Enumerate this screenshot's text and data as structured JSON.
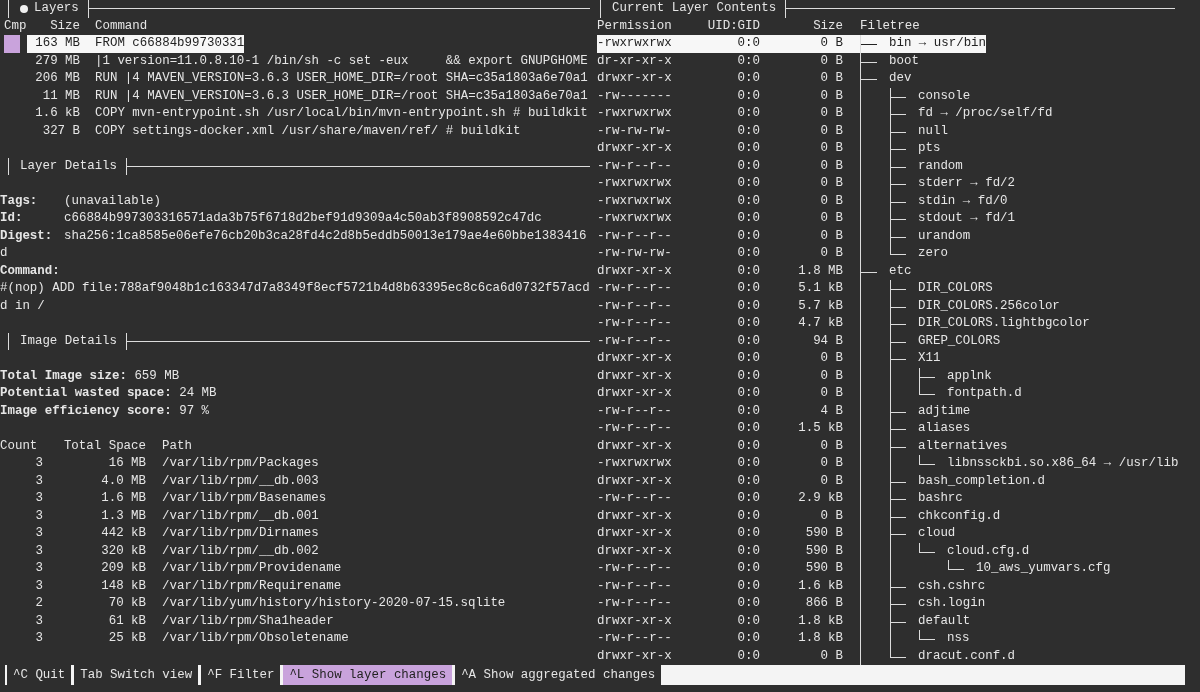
{
  "layers_pane": {
    "title": "Layers",
    "focused": true,
    "columns": [
      "Cmp",
      "Size",
      "Command"
    ],
    "rows": [
      {
        "compared": true,
        "size": "163 MB",
        "command": "FROM c66884b99730331",
        "selected": true
      },
      {
        "compared": false,
        "size": "279 MB",
        "command": "|1 version=11.0.8.10-1 /bin/sh -c set -eux     && export GNUPGHOME",
        "selected": false
      },
      {
        "compared": false,
        "size": "206 MB",
        "command": "RUN |4 MAVEN_VERSION=3.6.3 USER_HOME_DIR=/root SHA=c35a1803a6e70a1",
        "selected": false
      },
      {
        "compared": false,
        "size": "11 MB",
        "command": "RUN |4 MAVEN_VERSION=3.6.3 USER_HOME_DIR=/root SHA=c35a1803a6e70a1",
        "selected": false
      },
      {
        "compared": false,
        "size": "1.6 kB",
        "command": "COPY mvn-entrypoint.sh /usr/local/bin/mvn-entrypoint.sh # buildkit",
        "selected": false
      },
      {
        "compared": false,
        "size": "327 B",
        "command": "COPY settings-docker.xml /usr/share/maven/ref/ # buildkit",
        "selected": false
      }
    ]
  },
  "layer_details": {
    "title": "Layer Details",
    "focused": false,
    "fields": [
      {
        "label": "Tags:",
        "value": "(unavailable)"
      },
      {
        "label": "Id:",
        "value": "c66884b997303316571ada3b75f6718d2bef91d9309a4c50ab3f8908592c47dc"
      },
      {
        "label": "Digest:",
        "value": "sha256:1ca8585e06efe76cb20b3ca28fd4c2d8b5eddb50013e179ae4e60bbe1383416d"
      }
    ],
    "command_label": "Command:",
    "command": "#(nop) ADD file:788af9048b1c163347d7a8349f8ecf5721b4d8b63395ec8c6ca6d0732f57acdd in /"
  },
  "image_details": {
    "title": "Image Details",
    "focused": false,
    "stats": [
      {
        "label": "Total Image size:",
        "value": "659 MB"
      },
      {
        "label": "Potential wasted space:",
        "value": "24 MB"
      },
      {
        "label": "Image efficiency score:",
        "value": "97 %"
      }
    ],
    "columns": [
      "Count",
      "Total Space",
      "Path"
    ],
    "rows": [
      {
        "count": "3",
        "space": "16 MB",
        "path": "/var/lib/rpm/Packages"
      },
      {
        "count": "3",
        "space": "4.0 MB",
        "path": "/var/lib/rpm/__db.003"
      },
      {
        "count": "3",
        "space": "1.6 MB",
        "path": "/var/lib/rpm/Basenames"
      },
      {
        "count": "3",
        "space": "1.3 MB",
        "path": "/var/lib/rpm/__db.001"
      },
      {
        "count": "3",
        "space": "442 kB",
        "path": "/var/lib/rpm/Dirnames"
      },
      {
        "count": "3",
        "space": "320 kB",
        "path": "/var/lib/rpm/__db.002"
      },
      {
        "count": "3",
        "space": "209 kB",
        "path": "/var/lib/rpm/Providename"
      },
      {
        "count": "3",
        "space": "148 kB",
        "path": "/var/lib/rpm/Requirename"
      },
      {
        "count": "2",
        "space": "70 kB",
        "path": "/var/lib/yum/history/history-2020-07-15.sqlite"
      },
      {
        "count": "3",
        "space": "61 kB",
        "path": "/var/lib/rpm/Sha1header"
      },
      {
        "count": "3",
        "space": "25 kB",
        "path": "/var/lib/rpm/Obsoletename"
      }
    ]
  },
  "contents_pane": {
    "title": "Current Layer Contents",
    "focused": false,
    "columns": [
      "Permission",
      "UID:GID",
      "Size",
      "Filetree"
    ],
    "tree": [
      {
        "permission": "-rwxrwxrwx",
        "uid_gid": "0:0",
        "size": "0 B",
        "name": "bin → usr/bin",
        "selected": true
      },
      {
        "permission": "dr-xr-xr-x",
        "uid_gid": "0:0",
        "size": "0 B",
        "name": "boot",
        "selected": false
      },
      {
        "permission": "drwxr-xr-x",
        "uid_gid": "0:0",
        "size": "0 B",
        "name": "dev",
        "selected": false,
        "children": [
          {
            "permission": "-rw-------",
            "uid_gid": "0:0",
            "size": "0 B",
            "name": "console",
            "selected": false
          },
          {
            "permission": "-rwxrwxrwx",
            "uid_gid": "0:0",
            "size": "0 B",
            "name": "fd → /proc/self/fd",
            "selected": false
          },
          {
            "permission": "-rw-rw-rw-",
            "uid_gid": "0:0",
            "size": "0 B",
            "name": "null",
            "selected": false
          },
          {
            "permission": "drwxr-xr-x",
            "uid_gid": "0:0",
            "size": "0 B",
            "name": "pts",
            "selected": false
          },
          {
            "permission": "-rw-r--r--",
            "uid_gid": "0:0",
            "size": "0 B",
            "name": "random",
            "selected": false
          },
          {
            "permission": "-rwxrwxrwx",
            "uid_gid": "0:0",
            "size": "0 B",
            "name": "stderr → fd/2",
            "selected": false
          },
          {
            "permission": "-rwxrwxrwx",
            "uid_gid": "0:0",
            "size": "0 B",
            "name": "stdin → fd/0",
            "selected": false
          },
          {
            "permission": "-rwxrwxrwx",
            "uid_gid": "0:0",
            "size": "0 B",
            "name": "stdout → fd/1",
            "selected": false
          },
          {
            "permission": "-rw-r--r--",
            "uid_gid": "0:0",
            "size": "0 B",
            "name": "urandom",
            "selected": false
          },
          {
            "permission": "-rw-rw-rw-",
            "uid_gid": "0:0",
            "size": "0 B",
            "name": "zero",
            "selected": false
          }
        ]
      },
      {
        "permission": "drwxr-xr-x",
        "uid_gid": "0:0",
        "size": "1.8 MB",
        "name": "etc",
        "selected": false,
        "children": [
          {
            "permission": "-rw-r--r--",
            "uid_gid": "0:0",
            "size": "5.1 kB",
            "name": "DIR_COLORS",
            "selected": false
          },
          {
            "permission": "-rw-r--r--",
            "uid_gid": "0:0",
            "size": "5.7 kB",
            "name": "DIR_COLORS.256color",
            "selected": false
          },
          {
            "permission": "-rw-r--r--",
            "uid_gid": "0:0",
            "size": "4.7 kB",
            "name": "DIR_COLORS.lightbgcolor",
            "selected": false
          },
          {
            "permission": "-rw-r--r--",
            "uid_gid": "0:0",
            "size": "94 B",
            "name": "GREP_COLORS",
            "selected": false
          },
          {
            "permission": "drwxr-xr-x",
            "uid_gid": "0:0",
            "size": "0 B",
            "name": "X11",
            "selected": false,
            "children": [
              {
                "permission": "drwxr-xr-x",
                "uid_gid": "0:0",
                "size": "0 B",
                "name": "applnk",
                "selected": false
              },
              {
                "permission": "drwxr-xr-x",
                "uid_gid": "0:0",
                "size": "0 B",
                "name": "fontpath.d",
                "selected": false
              }
            ]
          },
          {
            "permission": "-rw-r--r--",
            "uid_gid": "0:0",
            "size": "4 B",
            "name": "adjtime",
            "selected": false
          },
          {
            "permission": "-rw-r--r--",
            "uid_gid": "0:0",
            "size": "1.5 kB",
            "name": "aliases",
            "selected": false
          },
          {
            "permission": "drwxr-xr-x",
            "uid_gid": "0:0",
            "size": "0 B",
            "name": "alternatives",
            "selected": false,
            "children": [
              {
                "permission": "-rwxrwxrwx",
                "uid_gid": "0:0",
                "size": "0 B",
                "name": "libnssckbi.so.x86_64 → /usr/lib",
                "selected": false
              }
            ]
          },
          {
            "permission": "drwxr-xr-x",
            "uid_gid": "0:0",
            "size": "0 B",
            "name": "bash_completion.d",
            "selected": false
          },
          {
            "permission": "-rw-r--r--",
            "uid_gid": "0:0",
            "size": "2.9 kB",
            "name": "bashrc",
            "selected": false
          },
          {
            "permission": "drwxr-xr-x",
            "uid_gid": "0:0",
            "size": "0 B",
            "name": "chkconfig.d",
            "selected": false
          },
          {
            "permission": "drwxr-xr-x",
            "uid_gid": "0:0",
            "size": "590 B",
            "name": "cloud",
            "selected": false,
            "children": [
              {
                "permission": "drwxr-xr-x",
                "uid_gid": "0:0",
                "size": "590 B",
                "name": "cloud.cfg.d",
                "selected": false,
                "children": [
                  {
                    "permission": "-rw-r--r--",
                    "uid_gid": "0:0",
                    "size": "590 B",
                    "name": "10_aws_yumvars.cfg",
                    "selected": false
                  }
                ]
              }
            ]
          },
          {
            "permission": "-rw-r--r--",
            "uid_gid": "0:0",
            "size": "1.6 kB",
            "name": "csh.cshrc",
            "selected": false
          },
          {
            "permission": "-rw-r--r--",
            "uid_gid": "0:0",
            "size": "866 B",
            "name": "csh.login",
            "selected": false
          },
          {
            "permission": "drwxr-xr-x",
            "uid_gid": "0:0",
            "size": "1.8 kB",
            "name": "default",
            "selected": false,
            "children": [
              {
                "permission": "-rw-r--r--",
                "uid_gid": "0:0",
                "size": "1.8 kB",
                "name": "nss",
                "selected": false
              }
            ]
          },
          {
            "permission": "drwxr-xr-x",
            "uid_gid": "0:0",
            "size": "0 B",
            "name": "dracut.conf.d",
            "selected": false
          }
        ]
      }
    ]
  },
  "key_bar": [
    {
      "label": "^C Quit",
      "active": false
    },
    {
      "label": "Tab Switch view",
      "active": false
    },
    {
      "label": "^F Filter",
      "active": false
    },
    {
      "label": "^L Show layer changes",
      "active": true
    },
    {
      "label": "^A Show aggregated changes",
      "active": false
    }
  ]
}
